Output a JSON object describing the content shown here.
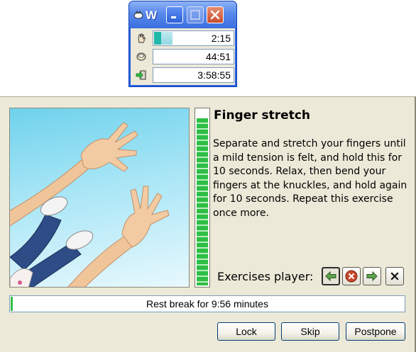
{
  "mini_window": {
    "title": "W",
    "rows": [
      {
        "icon": "hand-icon",
        "value": "2:15",
        "progress": 0.22
      },
      {
        "icon": "bowl-icon",
        "value": "44:51",
        "progress": 0.0
      },
      {
        "icon": "exit-icon",
        "value": "3:58:55",
        "progress": 0.0
      }
    ]
  },
  "break_window": {
    "exercise_title": "Finger stretch",
    "exercise_text": "Separate and stretch your fingers until a mild tension is felt, and hold this for 10 seconds. Relax, then bend your fingers at the knuckles, and hold again for 10 seconds. Repeat this exercise once more.",
    "exercise_progress": 0.95,
    "player_label": "Exercises player:",
    "player_buttons": [
      "back-arrow-icon",
      "stop-icon",
      "forward-arrow-icon",
      "close-x-icon"
    ],
    "rest_break_text": "Rest break for 9:56 minutes",
    "rest_break_progress": 0.005,
    "buttons": {
      "lock": "Lock",
      "skip": "Skip",
      "postpone": "Postpone"
    }
  },
  "colors": {
    "meter_green": "#2fbe45",
    "window_bg": "#ece9d8",
    "xp_blue": "#3c6fe0"
  }
}
